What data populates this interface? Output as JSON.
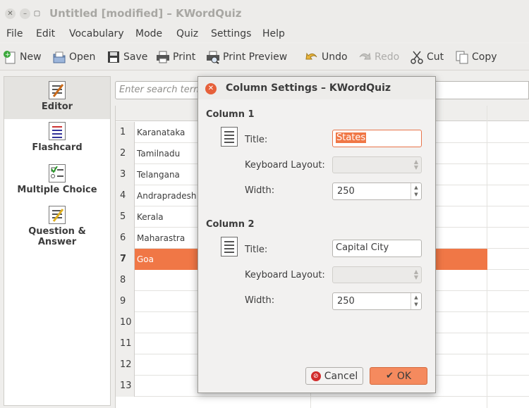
{
  "window": {
    "title": "Untitled [modified] – KWordQuiz"
  },
  "menu": [
    "File",
    "Edit",
    "Vocabulary",
    "Mode",
    "Quiz",
    "Settings",
    "Help"
  ],
  "toolbar": {
    "new": "New",
    "open": "Open",
    "save": "Save",
    "print": "Print",
    "print_preview": "Print Preview",
    "undo": "Undo",
    "redo": "Redo",
    "cut": "Cut",
    "copy": "Copy"
  },
  "sidebar": {
    "editor": "Editor",
    "flashcard": "Flashcard",
    "multiple_choice": "Multiple Choice",
    "qa_line1": "Question &",
    "qa_line2": "Answer"
  },
  "search": {
    "placeholder": "Enter search term"
  },
  "rows": [
    {
      "num": "1",
      "col1": "Karanataka"
    },
    {
      "num": "2",
      "col1": "Tamilnadu"
    },
    {
      "num": "3",
      "col1": "Telangana"
    },
    {
      "num": "4",
      "col1": "Andrapradesh"
    },
    {
      "num": "5",
      "col1": "Kerala"
    },
    {
      "num": "6",
      "col1": "Maharastra"
    },
    {
      "num": "7",
      "col1": "Goa"
    },
    {
      "num": "8",
      "col1": ""
    },
    {
      "num": "9",
      "col1": ""
    },
    {
      "num": "10",
      "col1": ""
    },
    {
      "num": "11",
      "col1": ""
    },
    {
      "num": "12",
      "col1": ""
    },
    {
      "num": "13",
      "col1": ""
    }
  ],
  "selected_row": "7",
  "dialog": {
    "title": "Column Settings – KWordQuiz",
    "col1_header": "Column 1",
    "col2_header": "Column 2",
    "title_label": "Title:",
    "keyboard_label": "Keyboard Layout:",
    "width_label": "Width:",
    "col1_title": "States",
    "col1_width": "250",
    "col2_title": "Capital City",
    "col2_width": "250",
    "cancel": "Cancel",
    "ok": "OK"
  },
  "colors": {
    "accent": "#f07746",
    "close": "#e6603a"
  }
}
